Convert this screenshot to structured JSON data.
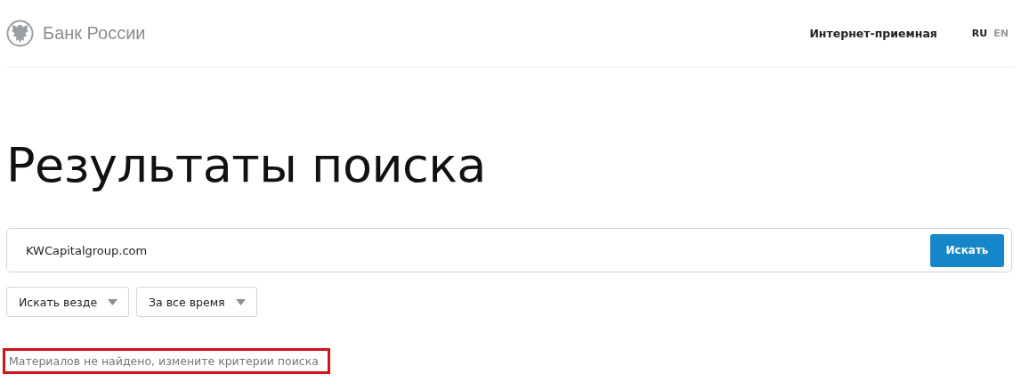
{
  "header": {
    "logo_text": "Банк России",
    "nav_link": "Интернет-приемная",
    "languages": [
      {
        "label": "RU",
        "selected": true
      },
      {
        "label": "EN",
        "selected": false
      }
    ]
  },
  "title": "Результаты поиска",
  "search": {
    "value": "KWCapitalgroup.com",
    "button": "Искать"
  },
  "filters": [
    {
      "label": "Искать везде"
    },
    {
      "label": "За все время"
    }
  ],
  "message": {
    "text": "Материалов не найдено, измените критерии поиска",
    "highlighted": true
  }
}
